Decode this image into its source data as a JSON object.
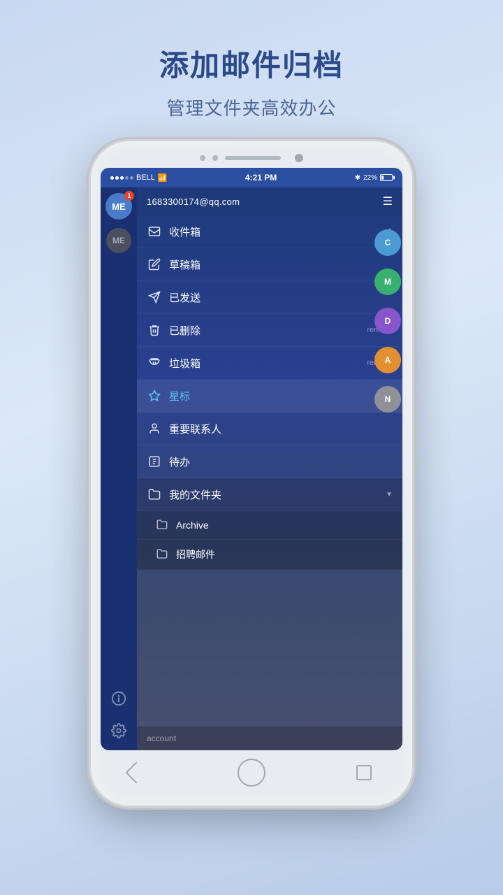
{
  "page": {
    "title": "添加邮件归档",
    "subtitle": "管理文件夹高效办公"
  },
  "status_bar": {
    "carrier": "BELL",
    "time": "4:21 PM",
    "battery": "22%"
  },
  "account": {
    "email": "1683300174@qq.com"
  },
  "menu": {
    "inbox": {
      "label": "收件箱",
      "badge": "1",
      "icon": "mail"
    },
    "drafts": {
      "label": "草稿箱",
      "icon": "draft"
    },
    "sent": {
      "label": "已发送",
      "icon": "send"
    },
    "deleted": {
      "label": "已删除",
      "action": "remove",
      "icon": "trash"
    },
    "junk": {
      "label": "垃圾箱",
      "action": "remove",
      "icon": "junk"
    },
    "starred": {
      "label": "星标",
      "icon": "star"
    },
    "important": {
      "label": "重要联系人",
      "icon": "person"
    },
    "todo": {
      "label": "待办",
      "icon": "todo"
    },
    "folders": {
      "label": "我的文件夹",
      "items": [
        {
          "label": "Archive",
          "icon": "folder"
        },
        {
          "label": "招聘邮件",
          "icon": "folder"
        }
      ]
    }
  },
  "bottom": {
    "account_label": "account"
  },
  "avatars": {
    "primary": "ME",
    "secondary": "ME",
    "badge": "1",
    "right": [
      {
        "label": "C",
        "color": "#4a9ad4"
      },
      {
        "label": "M",
        "color": "#3ab070"
      },
      {
        "label": "D",
        "color": "#8855cc"
      },
      {
        "label": "A",
        "color": "#e09030"
      },
      {
        "label": "N",
        "color": "#909098"
      }
    ]
  }
}
